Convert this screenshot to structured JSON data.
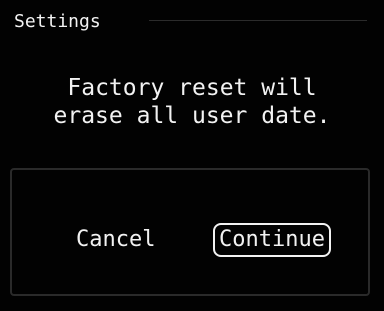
{
  "header": {
    "title": "Settings"
  },
  "message": {
    "line1": "Factory reset will",
    "line2": "erase all user date."
  },
  "buttons": {
    "cancel_label": "Cancel",
    "continue_label": "Continue"
  },
  "colors": {
    "background": "#000000",
    "text": "#f2f2f2",
    "divider": "#2b2b2b"
  }
}
